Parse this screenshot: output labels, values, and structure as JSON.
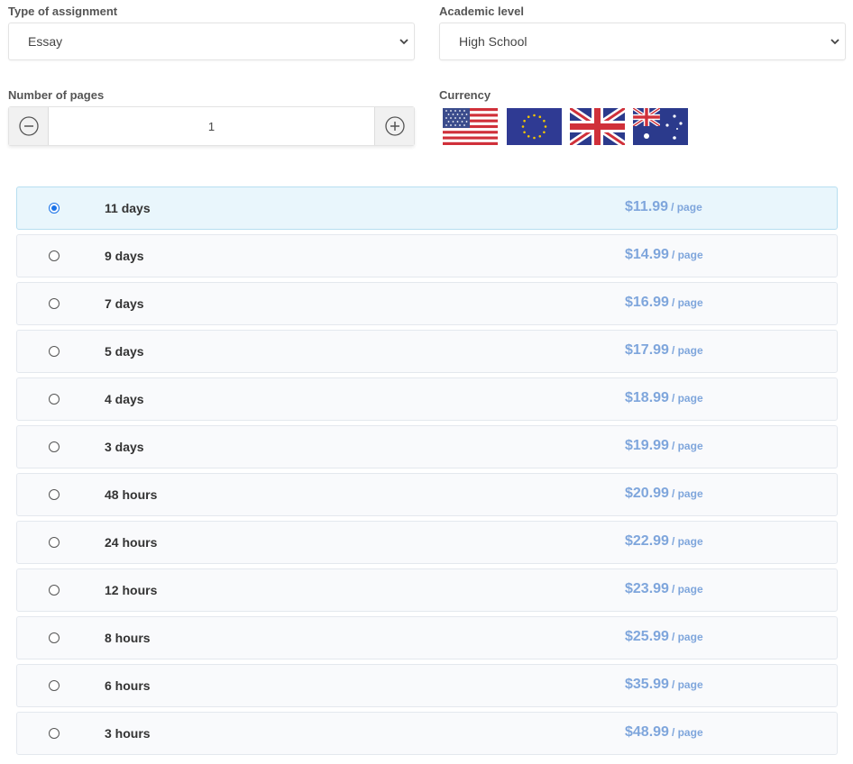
{
  "assignment": {
    "label": "Type of assignment",
    "value": "Essay"
  },
  "academic": {
    "label": "Academic level",
    "value": "High School"
  },
  "pages": {
    "label": "Number of pages",
    "value": "1"
  },
  "currency": {
    "label": "Currency",
    "flags": [
      "us-flag-icon",
      "eu-flag-icon",
      "uk-flag-icon",
      "au-flag-icon"
    ]
  },
  "colors": {
    "accent": "#1a73e8",
    "price": "#7fa6dc",
    "selected_row": "#e9f6fc"
  },
  "deadlines": [
    {
      "label": "11 days",
      "price": "$11.99",
      "unit": "/ page",
      "selected": true
    },
    {
      "label": "9 days",
      "price": "$14.99",
      "unit": "/ page"
    },
    {
      "label": "7 days",
      "price": "$16.99",
      "unit": "/ page"
    },
    {
      "label": "5 days",
      "price": "$17.99",
      "unit": "/ page"
    },
    {
      "label": "4 days",
      "price": "$18.99",
      "unit": "/ page"
    },
    {
      "label": "3 days",
      "price": "$19.99",
      "unit": "/ page"
    },
    {
      "label": "48 hours",
      "price": "$20.99",
      "unit": "/ page"
    },
    {
      "label": "24 hours",
      "price": "$22.99",
      "unit": "/ page"
    },
    {
      "label": "12 hours",
      "price": "$23.99",
      "unit": "/ page"
    },
    {
      "label": "8 hours",
      "price": "$25.99",
      "unit": "/ page"
    },
    {
      "label": "6 hours",
      "price": "$35.99",
      "unit": "/ page"
    },
    {
      "label": "3 hours",
      "price": "$48.99",
      "unit": "/ page"
    }
  ]
}
